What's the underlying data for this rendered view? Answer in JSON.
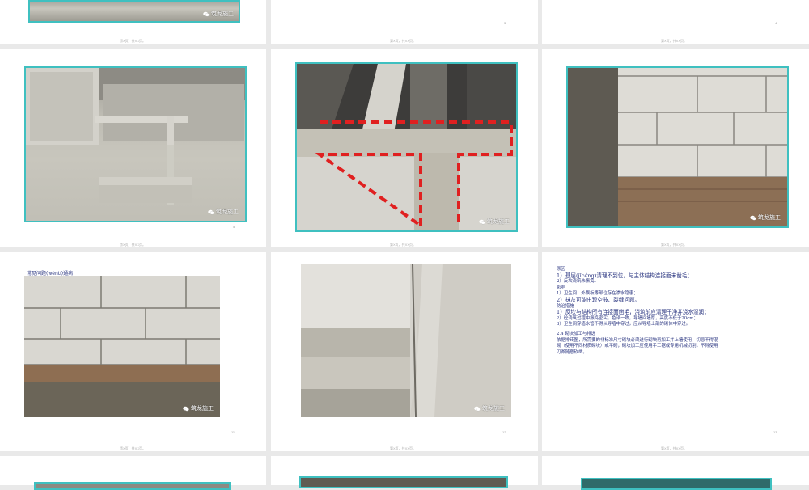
{
  "watermark": "筑龙施工",
  "pages": {
    "row1_left": {
      "number": ""
    },
    "row1_mid": {
      "number": "3"
    },
    "row1_right": {
      "number": "4"
    },
    "row2_left": {
      "number": "5"
    },
    "row3_left": {
      "number": "11",
      "title": "常见问题(wèntí)通病"
    },
    "row3_mid": {
      "number": "12"
    },
    "row3_right": {
      "number": "13"
    }
  },
  "footer_text": "第X页，共XX页。",
  "text_page": {
    "lines": [
      "原因",
      "1）基层(jīcéng)清理不到位，与主体结构连接面未凿毛；",
      "2）反坎浇筑未振捣。",
      "影响",
      "1）卫生间、外飘板等部位存在渗水隐患；",
      "2）抹灰可能出现空鼓、裂缝问题。",
      "防治措施",
      "1）反坎与结构所有连接面凿毛，浇筑前应清理干净并浇水湿润；",
      "2）砼浇筑过程中振捣密实，色泽一致，导墙间墙厚，高度不低于20cm；",
      "3）卫生间穿墙水管不得从导墙中穿过，应从导墙上部的砌体中穿过。",
      "",
      "2.4 砌块加工与排选",
      "依据排砖图，所需要的非标准尺寸砌块必须进行砌块再加工并上墙使用，切忌不得混",
      "砌（使用不同材质砌块）或平砌，砌块加工应使用手工锯或专用机械切割，不得使用",
      "刀斧随意砍凿。"
    ]
  },
  "colors": {
    "background": "#e9e9e9",
    "frame": "#3fc0c0",
    "text": "#2a3580",
    "dashed_outline": "#e02020"
  }
}
